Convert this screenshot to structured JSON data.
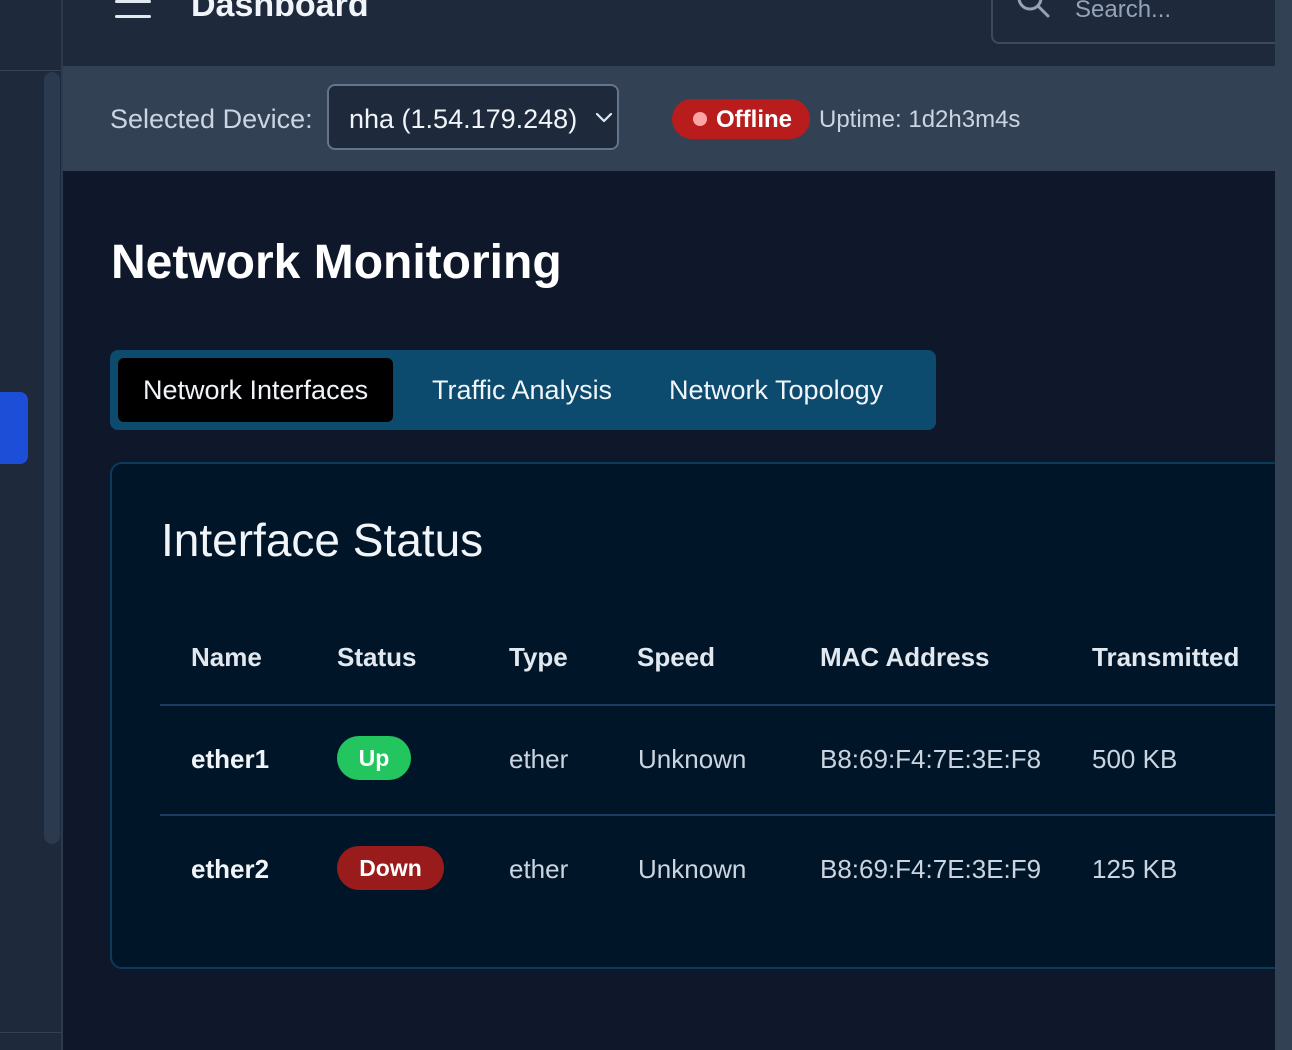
{
  "header": {
    "title": "Dashboard",
    "search_placeholder": "Search..."
  },
  "device_bar": {
    "label": "Selected Device:",
    "selected_device": "nha (1.54.179.248)",
    "status": "Offline",
    "uptime": "Uptime: 1d2h3m4s"
  },
  "page": {
    "title": "Network Monitoring"
  },
  "tabs": [
    {
      "label": "Network Interfaces",
      "active": true
    },
    {
      "label": "Traffic Analysis",
      "active": false
    },
    {
      "label": "Network Topology",
      "active": false
    }
  ],
  "panel": {
    "title": "Interface Status",
    "columns": [
      "Name",
      "Status",
      "Type",
      "Speed",
      "MAC Address",
      "Transmitted"
    ],
    "rows": [
      {
        "name": "ether1",
        "status": "Up",
        "type": "ether",
        "speed": "Unknown",
        "mac": "B8:69:F4:7E:3E:F8",
        "transmitted": "500 KB"
      },
      {
        "name": "ether2",
        "status": "Down",
        "type": "ether",
        "speed": "Unknown",
        "mac": "B8:69:F4:7E:3E:F9",
        "transmitted": "125 KB"
      }
    ]
  },
  "colors": {
    "status_up": "#22c55e",
    "status_down": "#991b1b",
    "offline": "#b91c1c",
    "tab_bar": "#0c4a6e"
  }
}
